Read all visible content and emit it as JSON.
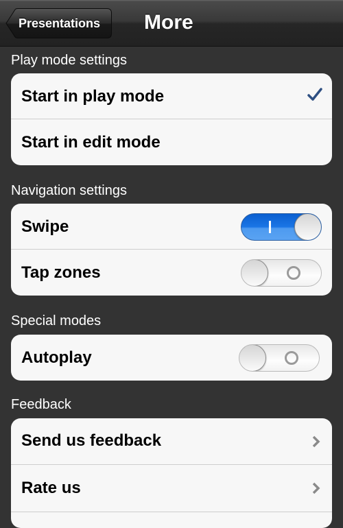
{
  "navbar": {
    "back_label": "Presentations",
    "title": "More"
  },
  "sections": [
    {
      "header": "Play mode settings",
      "rows": [
        {
          "label": "Start in play mode",
          "accessory": "checkmark-icon",
          "selected": true
        },
        {
          "label": "Start in edit mode",
          "accessory": "none",
          "selected": false
        }
      ]
    },
    {
      "header": "Navigation settings",
      "rows": [
        {
          "label": "Swipe",
          "accessory": "toggle",
          "on": true
        },
        {
          "label": "Tap zones",
          "accessory": "toggle",
          "on": false
        }
      ]
    },
    {
      "header": "Special modes",
      "rows": [
        {
          "label": "Autoplay",
          "accessory": "toggle",
          "on": false
        }
      ]
    },
    {
      "header": "Feedback",
      "rows": [
        {
          "label": "Send us feedback",
          "accessory": "chevron-right-icon"
        },
        {
          "label": "Rate us",
          "accessory": "chevron-right-icon"
        }
      ]
    }
  ],
  "colors": {
    "background": "#333333",
    "checkmark": "#2e4f82",
    "toggle_on": "#1b76e6",
    "chevron": "#8a8a8a"
  }
}
